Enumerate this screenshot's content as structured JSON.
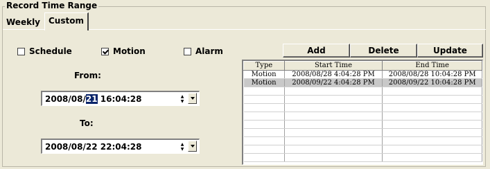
{
  "group": {
    "title": "Record Time Range"
  },
  "tabs": [
    {
      "label": "Weekly"
    },
    {
      "label": "Custom"
    }
  ],
  "checkboxes": {
    "schedule": {
      "label": "Schedule",
      "checked": false
    },
    "motion": {
      "label": "Motion",
      "checked": true
    },
    "alarm": {
      "label": "Alarm",
      "checked": false
    }
  },
  "from": {
    "label": "From:",
    "value_pre": "2008/08/",
    "value_sel": "21",
    "value_post": " 16:04:28"
  },
  "to": {
    "label": "To:",
    "value": "2008/08/22 22:04:28"
  },
  "buttons": {
    "add": "Add",
    "delete": "Delete",
    "update": "Update"
  },
  "table": {
    "columns": [
      "Type",
      "Start Time",
      "End Time"
    ],
    "rows": [
      {
        "type": "Motion",
        "start": "2008/08/28 4:04:28 PM",
        "end": "2008/08/28 10:04:28 PM",
        "selected": false
      },
      {
        "type": "Motion",
        "start": "2008/09/22 4:04:28 PM",
        "end": "2008/09/22 10:04:28 PM",
        "selected": true
      }
    ],
    "empty_rows": 9
  },
  "icons": {
    "spinner": "spin-up-down-icon",
    "dropdown": "dropdown-arrow-icon",
    "check": "check-icon"
  }
}
